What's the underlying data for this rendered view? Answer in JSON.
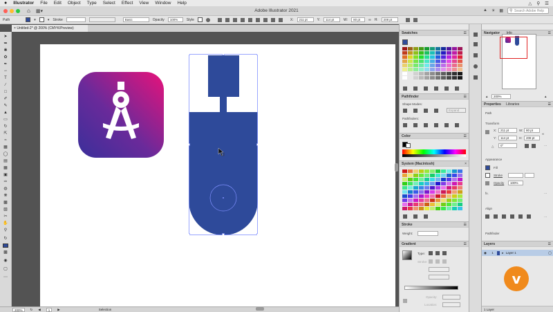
{
  "menubar": {
    "app_name": "Illustrator",
    "items": [
      "File",
      "Edit",
      "Object",
      "Type",
      "Select",
      "Effect",
      "View",
      "Window",
      "Help"
    ]
  },
  "titlebar": {
    "title": "Adobe Illustrator 2021",
    "search_placeholder": "Search Adobe Help"
  },
  "controlbar": {
    "selection_label": "Path",
    "stroke_label": "Stroke",
    "brush_label": "Basic",
    "opacity_label": "Opacity",
    "opacity_value": "100%",
    "style_label": "Style",
    "x_value": "211 pt",
    "y_value": "114 pt",
    "w_value": "80 pt",
    "h_value": "208 pt"
  },
  "document": {
    "tab_label": "Untitled-2* @ 200% (CMYK/Preview)"
  },
  "statusbar": {
    "zoom": "200%",
    "page": "1",
    "tool_name": "Selection"
  },
  "panels": {
    "swatches": {
      "title": "Swatches"
    },
    "pathfinder": {
      "title": "Pathfinder",
      "shape_modes_label": "Shape Modes:",
      "pathfinders_label": "Pathfinders:",
      "expand_label": "Expand"
    },
    "color": {
      "title": "Color"
    },
    "system_swatches": {
      "title": "System (Macintosh)"
    },
    "stroke": {
      "title": "Stroke",
      "weight_label": "Weight:"
    },
    "gradient": {
      "title": "Gradient",
      "type_label": "Type:",
      "stroke_label": "Stroke:",
      "opacity_label": "Opacity:",
      "location_label": "Location:"
    },
    "navigator": {
      "title": "Navigator",
      "info_tab": "Info",
      "zoom": "200%"
    },
    "properties": {
      "title": "Properties",
      "libraries_tab": "Libraries",
      "path_label": "Path",
      "transform_label": "Transform",
      "x_label": "X:",
      "x_value": "211 pt",
      "y_label": "Y:",
      "y_value": "114 pt",
      "w_label": "W:",
      "w_value": "80 pt",
      "h_label": "H:",
      "h_value": "208 pt",
      "rotate_value": "0°",
      "appearance_label": "Appearance",
      "fill_label": "Fill",
      "stroke_label": "Stroke",
      "opacity_label": "Opacity",
      "opacity_value": "100%",
      "fx_label": "fx.",
      "align_label": "Align",
      "pathfinder_label": "Pathfinder"
    },
    "layers": {
      "title": "Layers",
      "layer_name": "Layer 1",
      "layer_number": "1",
      "footer": "1 Layer"
    }
  },
  "colors": {
    "shape_fill": "#2e4a9a",
    "icon_gradient_start": "#3a2f9a",
    "icon_gradient_end": "#e8127a",
    "vimeo_orange": "#f08a1c"
  },
  "overlay": {
    "vimeo_glyph": "v"
  }
}
